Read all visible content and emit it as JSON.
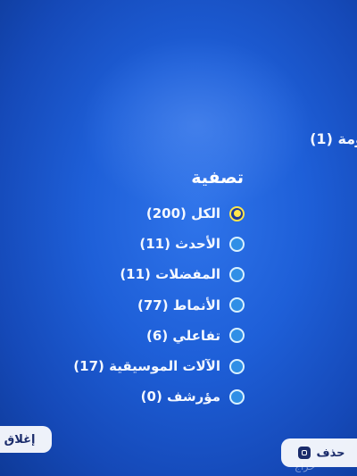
{
  "header": {
    "cropped_text": "ومة (1)"
  },
  "filter": {
    "title": "تصفية",
    "options": [
      {
        "label": "الكل (200)",
        "selected": true
      },
      {
        "label": "الأحدث (11)",
        "selected": false
      },
      {
        "label": "المفضلات (11)",
        "selected": false
      },
      {
        "label": "الأنماط (77)",
        "selected": false
      },
      {
        "label": "تفاعلي (6)",
        "selected": false
      },
      {
        "label": "الآلات الموسيقية (17)",
        "selected": false
      },
      {
        "label": "مؤرشف (0)",
        "selected": false
      }
    ]
  },
  "buttons": {
    "close_label": "إغلاق",
    "delete_label": "حذف"
  },
  "watermark": "حراج",
  "colors": {
    "background": "#1e5fd8",
    "selected_ring": "#ffe54d",
    "radio_fill": "#2f8fe6"
  },
  "icons": {
    "delete_button_icon": "square-button-icon"
  }
}
